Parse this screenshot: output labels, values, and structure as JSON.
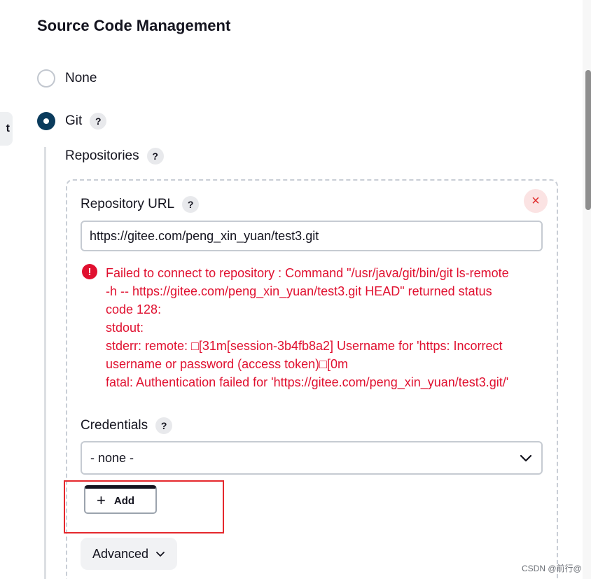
{
  "section": {
    "title": "Source Code Management"
  },
  "left_tab": {
    "label": "t"
  },
  "scm_options": [
    {
      "label": "None",
      "checked": false
    },
    {
      "label": "Git",
      "checked": true
    }
  ],
  "help_glyph": "?",
  "repositories": {
    "label": "Repositories",
    "repo_url_label": "Repository URL",
    "repo_url_value": "https://gitee.com/peng_xin_yuan/test3.git",
    "remove_glyph": "×",
    "error_glyph": "!",
    "error_lines": [
      "Failed to connect to repository : Command \"/usr/java/git/bin/git ls-remote",
      "-h -- https://gitee.com/peng_xin_yuan/test3.git HEAD\" returned status",
      "code 128:",
      "stdout:",
      "stderr: remote: □[31m[session-3b4fb8a2] Username for 'https: Incorrect",
      "username or password (access token)□[0m",
      "fatal: Authentication failed for 'https://gitee.com/peng_xin_yuan/test3.git/'"
    ],
    "credentials_label": "Credentials",
    "credentials_selected": "- none -",
    "add_plus": "+",
    "add_label": "Add",
    "advanced_label": "Advanced"
  },
  "watermark": "CSDN @前行@",
  "colors": {
    "accent": "#0a3b5c",
    "error": "#e0102f",
    "highlight": "#e5282d"
  }
}
